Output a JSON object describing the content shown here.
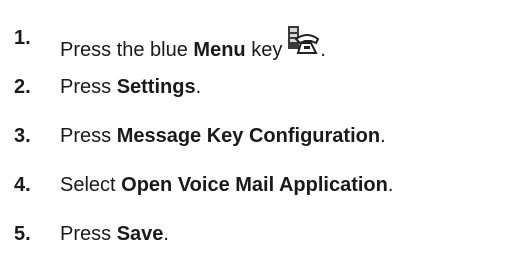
{
  "steps": [
    {
      "number": "1.",
      "prefix": "Press the blue ",
      "bold": "Menu",
      "suffix": " key",
      "icon": "phone-menu-icon",
      "after_icon": "."
    },
    {
      "number": "2.",
      "prefix": "Press ",
      "bold": "Settings",
      "suffix": "."
    },
    {
      "number": "3.",
      "prefix": "Press ",
      "bold": "Message Key Configuration",
      "suffix": "."
    },
    {
      "number": "4.",
      "prefix": "Select ",
      "bold": "Open Voice Mail Application",
      "suffix": "."
    },
    {
      "number": "5.",
      "prefix": "Press ",
      "bold": "Save",
      "suffix": "."
    }
  ]
}
